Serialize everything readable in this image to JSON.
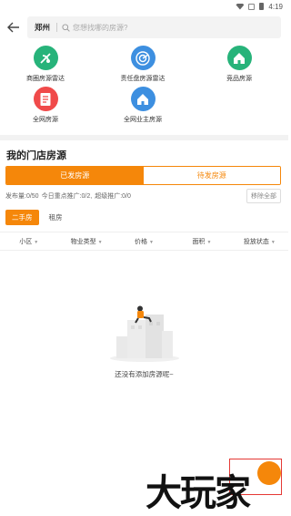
{
  "status_bar": {
    "time": "4:19"
  },
  "search": {
    "city": "郑州",
    "placeholder": "您想找哪的房源?"
  },
  "menu": [
    {
      "label": "商圈房源雷达",
      "icon": "radar-icon",
      "color": "#27b37a"
    },
    {
      "label": "责任盘房源雷达",
      "icon": "target-icon",
      "color": "#3d8fe0"
    },
    {
      "label": "竞品房源",
      "icon": "house-icon",
      "color": "#27b37a"
    },
    {
      "label": "全网房源",
      "icon": "document-icon",
      "color": "#f04a4a"
    },
    {
      "label": "全网业主房源",
      "icon": "house-icon",
      "color": "#3d8fe0"
    }
  ],
  "store_section": {
    "title": "我的门店房源",
    "tabs": [
      "已发房源",
      "待发房源"
    ],
    "stats": [
      "发布量:0/50",
      "今日重点推广:0/2,",
      "超级推广:0/0"
    ],
    "remove_all_label": "移除全部",
    "subtabs": [
      "二手房",
      "租房"
    ],
    "filters": [
      "小区",
      "物业类型",
      "价格",
      "面积",
      "投放状态"
    ],
    "empty_text": "还没有添加房源呢~"
  },
  "watermark_text": "大玩家",
  "colors": {
    "accent": "#f5870a"
  }
}
